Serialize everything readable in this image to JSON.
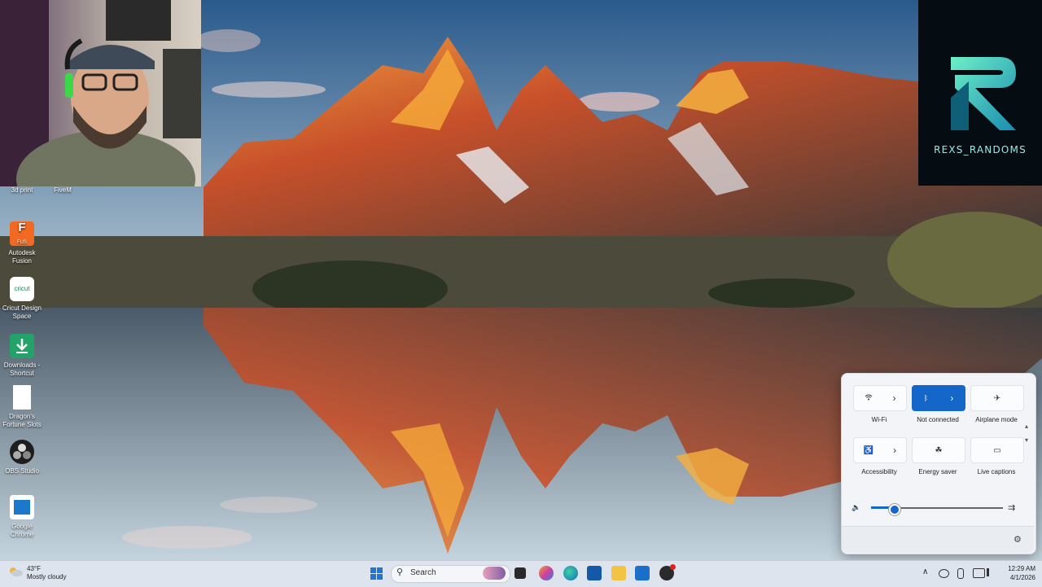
{
  "desktop": {
    "icons": [
      {
        "label": "3d print",
        "icon": "3d-print-icon"
      },
      {
        "label": "FiveM",
        "icon": "fivem-icon"
      },
      {
        "label": "Autodesk Fusion",
        "icon": "autodesk-fusion-icon",
        "badge": "F",
        "badge_sub": "FUS"
      },
      {
        "label": "Cricut Design Space",
        "icon": "cricut-icon",
        "badge": "cricut"
      },
      {
        "label": "Downloads - Shortcut",
        "icon": "downloads-folder-icon"
      },
      {
        "label": "Dragon's Fortune Slots",
        "icon": "document-icon"
      },
      {
        "label": "OBS Studio",
        "icon": "obs-studio-icon"
      },
      {
        "label": "Google Chrome",
        "icon": "google-chrome-icon"
      }
    ]
  },
  "brand": {
    "name": "REXS_RANDOMS"
  },
  "quick_settings": {
    "tiles": [
      {
        "label": "Wi-Fi",
        "icon": "wifi-icon",
        "active": false,
        "has_arrow": true
      },
      {
        "label": "Not connected",
        "icon": "bluetooth-icon",
        "active": true,
        "has_arrow": true
      },
      {
        "label": "Airplane mode",
        "icon": "airplane-icon",
        "active": false,
        "has_arrow": false
      },
      {
        "label": "Accessibility",
        "icon": "accessibility-icon",
        "active": false,
        "has_arrow": true
      },
      {
        "label": "Energy saver",
        "icon": "energy-saver-icon",
        "active": false,
        "has_arrow": false
      },
      {
        "label": "Live captions",
        "icon": "live-captions-icon",
        "active": false,
        "has_arrow": false
      }
    ],
    "volume_level": 0.17,
    "glyphs": {
      "arrow": "›",
      "volume": "🔈",
      "output": "⇉",
      "gear": "⚙",
      "up": "▴",
      "down": "▾"
    }
  },
  "taskbar": {
    "weather": {
      "temp": "43°F",
      "condition": "Mostly cloudy"
    },
    "search_placeholder": "Search",
    "search_glyph": "⚲",
    "apps": [
      "start-icon",
      "copilot-icon",
      "task-view-icon",
      "photos-icon",
      "edge-icon",
      "store-icon",
      "file-explorer-icon",
      "outlook-icon",
      "app-icon"
    ],
    "tray_glyph": "∧",
    "clock": {
      "time": "12:29 AM",
      "date": "4/1/2026"
    },
    "colors": {
      "accent": "#1467c8",
      "taskbar": "#dde4ee"
    }
  }
}
